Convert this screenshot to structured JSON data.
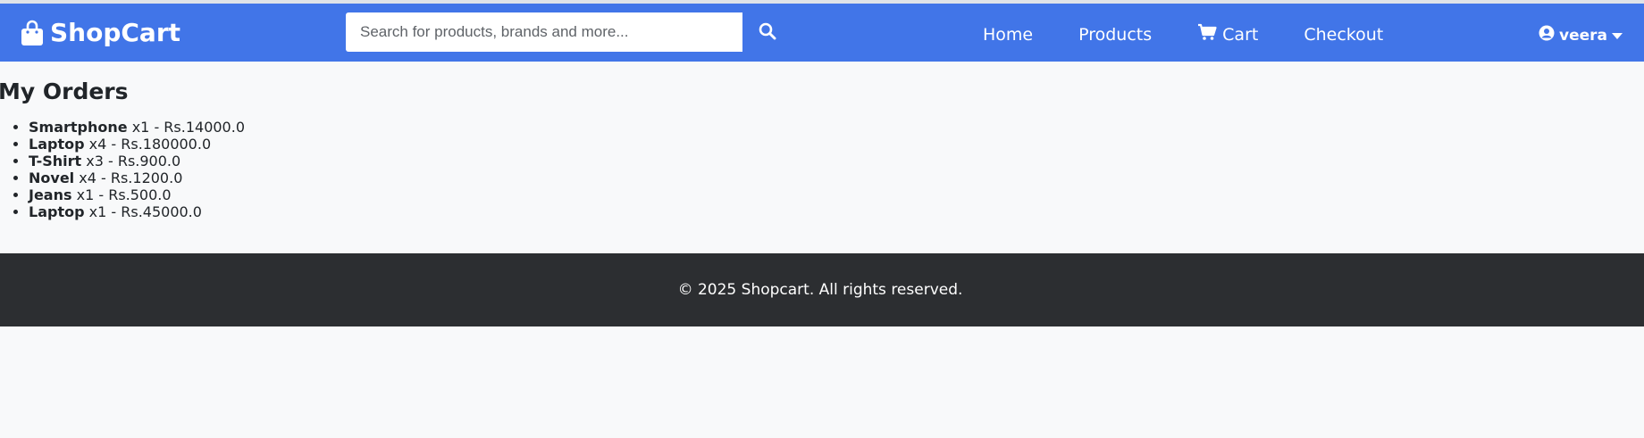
{
  "brand": {
    "name": "ShopCart"
  },
  "search": {
    "placeholder": "Search for products, brands and more..."
  },
  "nav": {
    "home": "Home",
    "products": "Products",
    "cart": "Cart",
    "checkout": "Checkout"
  },
  "user": {
    "name": "veera"
  },
  "page": {
    "title": "My Orders"
  },
  "orders": [
    {
      "name": "Smartphone",
      "detail": "x1 - Rs.14000.0"
    },
    {
      "name": "Laptop",
      "detail": "x4 - Rs.180000.0"
    },
    {
      "name": "T-Shirt",
      "detail": "x3 - Rs.900.0"
    },
    {
      "name": "Novel",
      "detail": "x4 - Rs.1200.0"
    },
    {
      "name": "Jeans",
      "detail": "x1 - Rs.500.0"
    },
    {
      "name": "Laptop",
      "detail": "x1 - Rs.45000.0"
    }
  ],
  "footer": {
    "text": "© 2025 Shopcart. All rights reserved."
  },
  "colors": {
    "navbar": "#4175e8",
    "footer": "#2c2e31",
    "background": "#f8f9fa"
  },
  "icons": {
    "brand": "shopping-bag-icon",
    "search": "search-icon",
    "cart": "cart-icon",
    "user": "user-circle-icon",
    "caret": "caret-down-icon"
  }
}
